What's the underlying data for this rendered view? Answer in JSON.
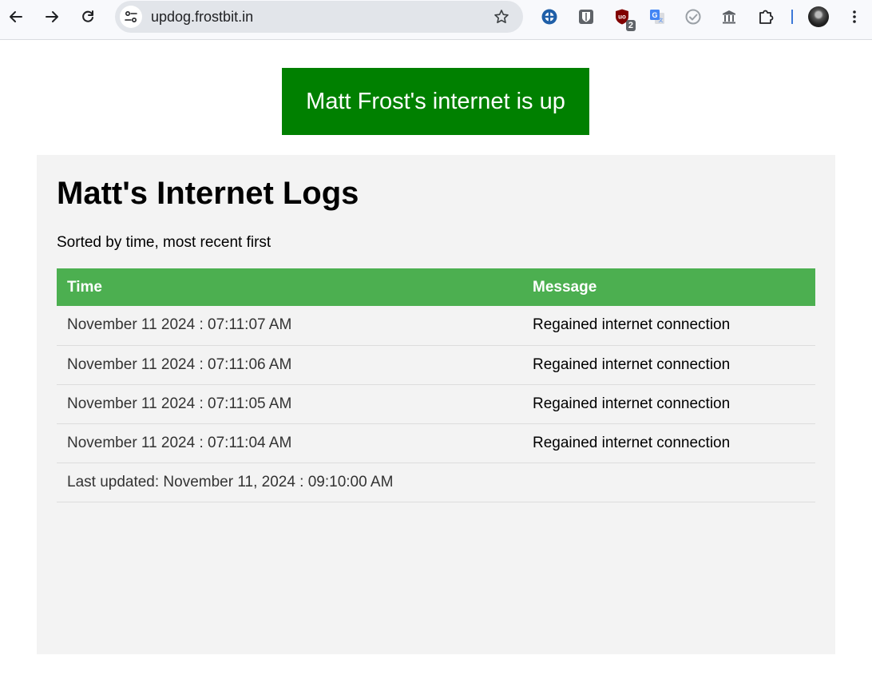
{
  "browser": {
    "url": "updog.frostbit.in",
    "extensions": [
      {
        "icon": "dashlane-icon"
      },
      {
        "icon": "bitwarden-icon"
      },
      {
        "icon": "ublock-icon",
        "badge": "2"
      },
      {
        "icon": "google-translate-icon"
      },
      {
        "icon": "checkmark-icon"
      },
      {
        "icon": "archive-icon"
      },
      {
        "icon": "extensions-puzzle-icon"
      }
    ]
  },
  "banner": {
    "text": "Matt Frost's internet is up",
    "color": "#008000"
  },
  "logs": {
    "title": "Matt's Internet Logs",
    "subtitle": "Sorted by time, most recent first",
    "header_color": "#4caf50",
    "columns": [
      "Time",
      "Message"
    ],
    "rows": [
      {
        "time": "November 11 2024 : 07:11:07 AM",
        "message": "Regained internet connection"
      },
      {
        "time": "November 11 2024 : 07:11:06 AM",
        "message": "Regained internet connection"
      },
      {
        "time": "November 11 2024 : 07:11:05 AM",
        "message": "Regained internet connection"
      },
      {
        "time": "November 11 2024 : 07:11:04 AM",
        "message": "Regained internet connection"
      }
    ],
    "last_updated": "Last updated: November 11, 2024 : 09:10:00 AM"
  }
}
